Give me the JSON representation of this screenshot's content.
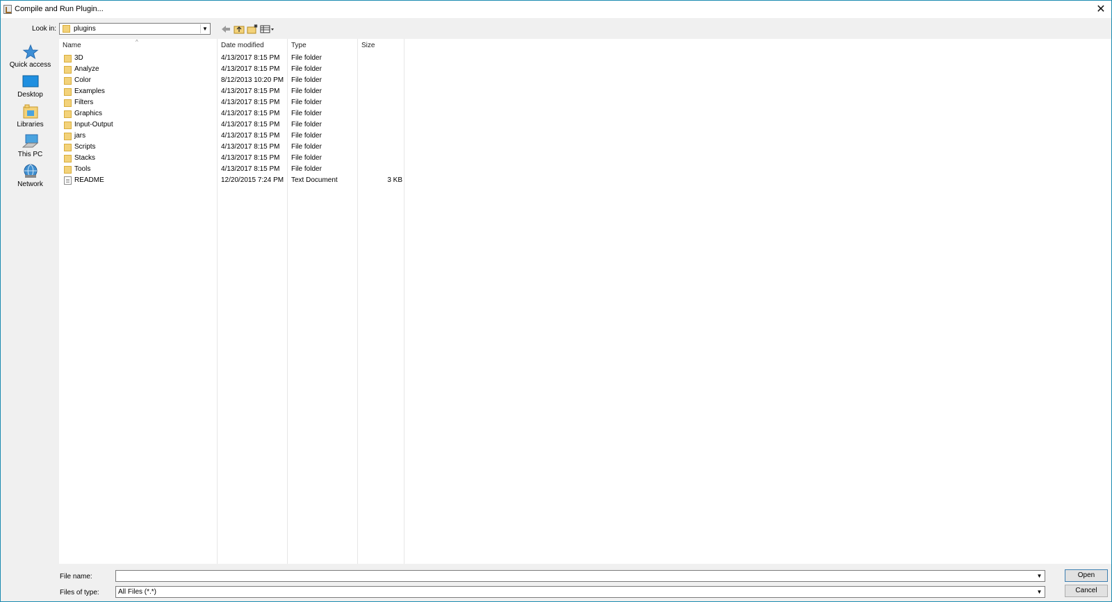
{
  "window": {
    "title": "Compile and Run Plugin..."
  },
  "lookin": {
    "label": "Look in:",
    "value": "plugins"
  },
  "places": [
    {
      "label": "Quick access"
    },
    {
      "label": "Desktop"
    },
    {
      "label": "Libraries"
    },
    {
      "label": "This PC"
    },
    {
      "label": "Network"
    }
  ],
  "columns": {
    "name": "Name",
    "date": "Date modified",
    "type": "Type",
    "size": "Size"
  },
  "files": [
    {
      "name": "3D",
      "date": "4/13/2017 8:15 PM",
      "type": "File folder",
      "size": "",
      "icon": "folder-icon"
    },
    {
      "name": "Analyze",
      "date": "4/13/2017 8:15 PM",
      "type": "File folder",
      "size": "",
      "icon": "folder-icon"
    },
    {
      "name": "Color",
      "date": "8/12/2013 10:20 PM",
      "type": "File folder",
      "size": "",
      "icon": "folder-icon"
    },
    {
      "name": "Examples",
      "date": "4/13/2017 8:15 PM",
      "type": "File folder",
      "size": "",
      "icon": "folder-icon"
    },
    {
      "name": "Filters",
      "date": "4/13/2017 8:15 PM",
      "type": "File folder",
      "size": "",
      "icon": "folder-icon"
    },
    {
      "name": "Graphics",
      "date": "4/13/2017 8:15 PM",
      "type": "File folder",
      "size": "",
      "icon": "folder-icon"
    },
    {
      "name": "Input-Output",
      "date": "4/13/2017 8:15 PM",
      "type": "File folder",
      "size": "",
      "icon": "folder-icon"
    },
    {
      "name": "jars",
      "date": "4/13/2017 8:15 PM",
      "type": "File folder",
      "size": "",
      "icon": "folder-icon"
    },
    {
      "name": "Scripts",
      "date": "4/13/2017 8:15 PM",
      "type": "File folder",
      "size": "",
      "icon": "folder-icon"
    },
    {
      "name": "Stacks",
      "date": "4/13/2017 8:15 PM",
      "type": "File folder",
      "size": "",
      "icon": "folder-icon"
    },
    {
      "name": "Tools",
      "date": "4/13/2017 8:15 PM",
      "type": "File folder",
      "size": "",
      "icon": "folder-icon"
    },
    {
      "name": "README",
      "date": "12/20/2015 7:24 PM",
      "type": "Text Document",
      "size": "3 KB",
      "icon": "document-icon"
    }
  ],
  "bottom": {
    "filename_label": "File name:",
    "filename_value": "",
    "filetype_label": "Files of type:",
    "filetype_value": "All Files (*.*)",
    "open_label": "Open",
    "cancel_label": "Cancel"
  }
}
